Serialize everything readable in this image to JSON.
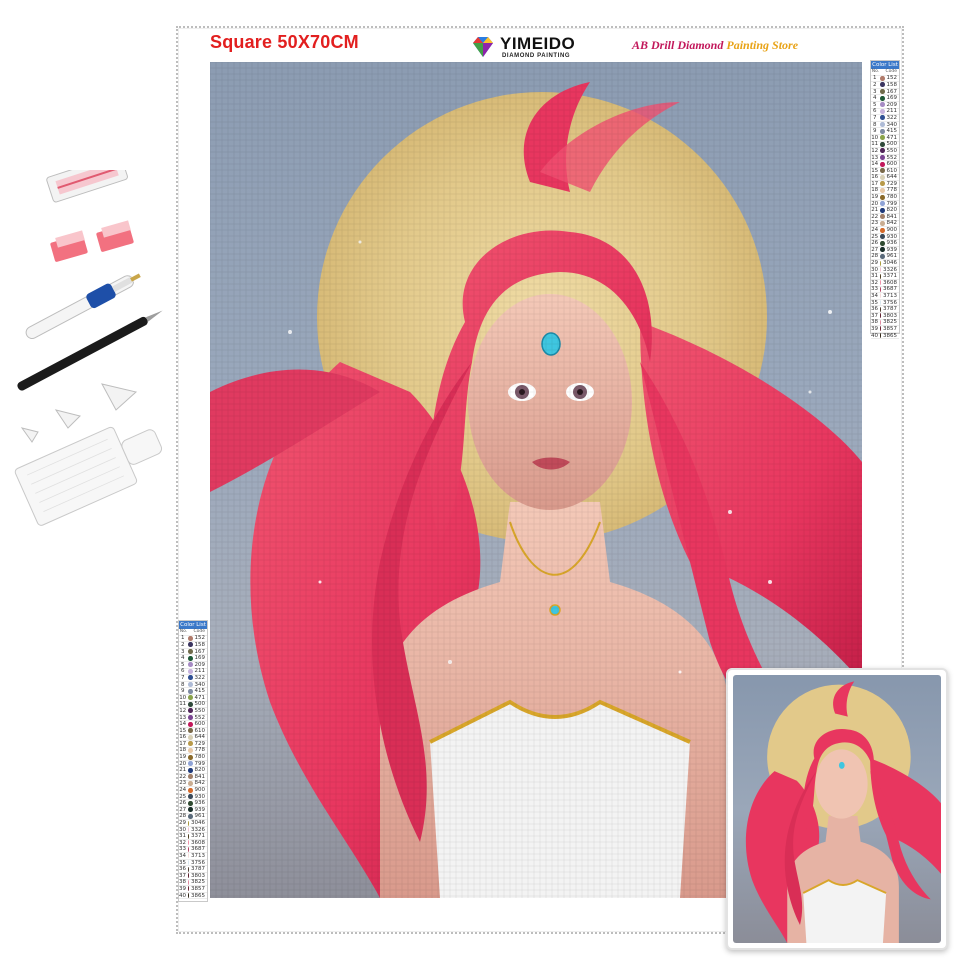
{
  "listing": {
    "size_title": "Square 50X70CM",
    "brand_name": "YIMEIDO",
    "brand_sub": "DIAMOND PAINTING",
    "store_part1": "AB Drill Diamond ",
    "store_part2": "Painting Store"
  },
  "colors": {
    "size_title": "#e21f1f",
    "hair": "#e8365f",
    "moon": "#e2c98a",
    "background": "#9aa8bc",
    "gem": "#3fc6e0",
    "dress": "#f3f3f3",
    "gold_trim": "#d9a62a"
  },
  "color_list": {
    "title": "Color List",
    "head_no": "No.",
    "head_code": "Code",
    "codes": [
      "152",
      "158",
      "167",
      "169",
      "209",
      "211",
      "322",
      "340",
      "415",
      "471",
      "500",
      "550",
      "552",
      "600",
      "610",
      "644",
      "729",
      "778",
      "780",
      "799",
      "820",
      "841",
      "842",
      "900",
      "930",
      "936",
      "939",
      "961",
      "3046",
      "3326",
      "3371",
      "3608",
      "3687",
      "3713",
      "3756",
      "3787",
      "3803",
      "3825",
      "3857",
      "3865"
    ],
    "swatches": [
      "#b07a6a",
      "#3b3560",
      "#6f6a4a",
      "#1f5a38",
      "#a68bc4",
      "#c7b3dd",
      "#2f4f93",
      "#aebbd6",
      "#7e8ba3",
      "#8aa34a",
      "#2f4a3a",
      "#51265a",
      "#7a4592",
      "#c2185b",
      "#7a6a4a",
      "#d8d0b6",
      "#b89a4a",
      "#e8c9a8",
      "#8a6a2a",
      "#8fa3d6",
      "#1f3a7a",
      "#a2806a",
      "#c9ad92",
      "#d56a2a",
      "#3a4a5a",
      "#2f4a30",
      "#1a2f2a",
      "#5a6a7a",
      "#a89a3a",
      "#f0c0d0",
      "#4a3a1a",
      "#f090a8",
      "#b04060",
      "#f2dad8",
      "#d8e6ee",
      "#4a3a2a",
      "#5a1a2a",
      "#e08aa0",
      "#6a2030",
      "#2a2010"
    ]
  },
  "tools": {
    "items": [
      "drill-bag",
      "wax-pads",
      "drill-pen",
      "tweezers",
      "multi-placer-tips",
      "drill-tray"
    ]
  }
}
